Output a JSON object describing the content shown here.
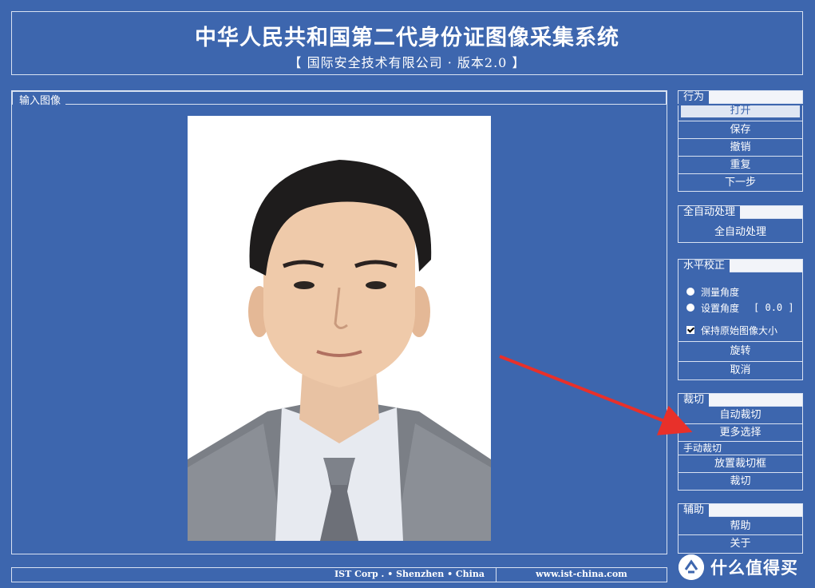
{
  "header": {
    "title": "中华人民共和国第二代身份证图像采集系统",
    "subtitle": "【 国际安全技术有限公司 · 版本2.0 】"
  },
  "input_panel": {
    "title": "输入图像"
  },
  "actions": {
    "title": "行为",
    "buttons": [
      "打开",
      "保存",
      "撤销",
      "重复",
      "下一步"
    ]
  },
  "auto_process": {
    "title": "全自动处理",
    "button": "全自动处理"
  },
  "level_correction": {
    "title": "水平校正",
    "measure_angle": "测量角度",
    "set_angle": "设置角度",
    "angle_value": "[ 0.0 ]",
    "keep_size": "保持原始图像大小",
    "rotate": "旋转",
    "cancel": "取消"
  },
  "crop": {
    "title": "裁切",
    "auto_crop": "自动裁切",
    "more_options": "更多选择",
    "manual_label": "手动裁切",
    "place_frame": "放置裁切框",
    "crop_button": "裁切"
  },
  "assist": {
    "title": "辅助",
    "help": "帮助",
    "about": "关于"
  },
  "footer": {
    "company": "IST Corp .  •   Shenzhen   •   China",
    "website": "www.ist-china.com"
  },
  "watermark": {
    "text": "什么值得买"
  },
  "colors": {
    "background": "#3d66ae",
    "border": "#d9e2f2",
    "arrow": "#e8302a"
  }
}
